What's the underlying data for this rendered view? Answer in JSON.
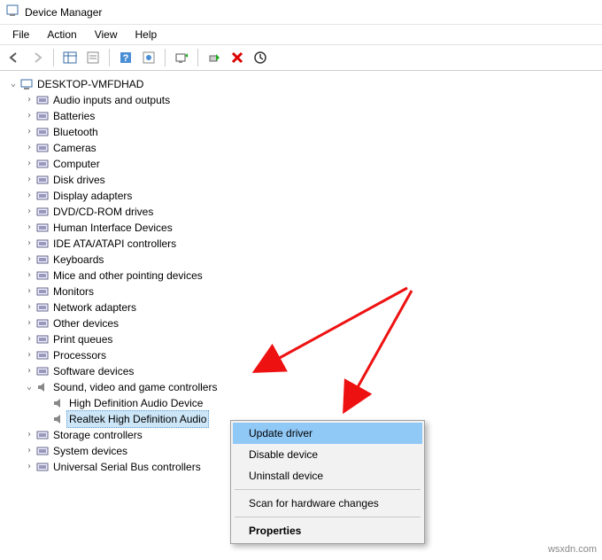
{
  "window": {
    "title": "Device Manager"
  },
  "menubar": [
    "File",
    "Action",
    "View",
    "Help"
  ],
  "tree": {
    "root": "DESKTOP-VMFDHAD",
    "categories": [
      "Audio inputs and outputs",
      "Batteries",
      "Bluetooth",
      "Cameras",
      "Computer",
      "Disk drives",
      "Display adapters",
      "DVD/CD-ROM drives",
      "Human Interface Devices",
      "IDE ATA/ATAPI controllers",
      "Keyboards",
      "Mice and other pointing devices",
      "Monitors",
      "Network adapters",
      "Other devices",
      "Print queues",
      "Processors",
      "Software devices"
    ],
    "expanded_category": "Sound, video and game controllers",
    "expanded_children": [
      "High Definition Audio Device",
      "Realtek High Definition Audio"
    ],
    "after_categories": [
      "Storage controllers",
      "System devices",
      "Universal Serial Bus controllers"
    ]
  },
  "context_menu": {
    "items": [
      "Update driver",
      "Disable device",
      "Uninstall device",
      "Scan for hardware changes",
      "Properties"
    ]
  },
  "watermark": "wsxdn.com"
}
